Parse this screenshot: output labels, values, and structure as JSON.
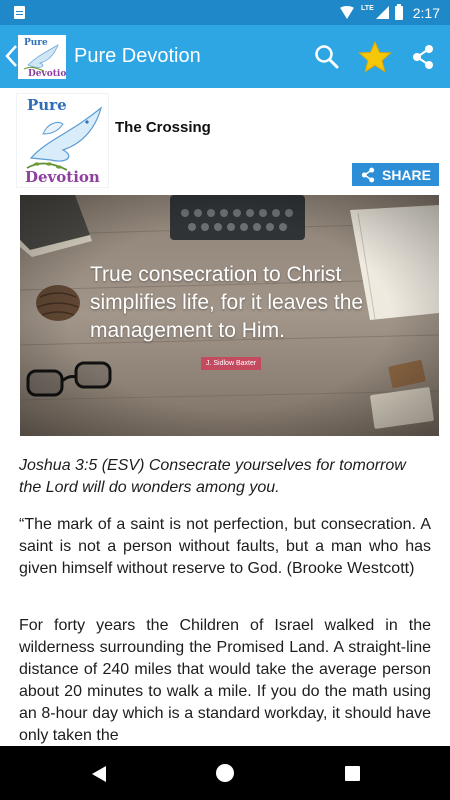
{
  "status_bar": {
    "network": "LTE",
    "battery_level": "2",
    "time": "2:17"
  },
  "app_bar": {
    "title": "Pure Devotion",
    "logo_text": [
      "Pure",
      "Devotion"
    ],
    "actions": [
      "search-icon",
      "star-icon",
      "share-icon"
    ],
    "star_color": "#f6c609"
  },
  "post": {
    "title": "The Crossing",
    "logo_text": [
      "Pure",
      "Devotion"
    ],
    "share_label": "SHARE",
    "image": {
      "quote": "True consecration to Christ simplifies life, for it leaves the management to Him.",
      "author": "J. Sidlow Baxter"
    },
    "verse": "Joshua 3:5 (ESV) Consecrate yourselves for tomorrow the Lord will do wonders among you.",
    "paragraphs": [
      "“The mark of a saint is not perfection, but consecration. A saint is not a person without faults, but a man who has given himself without reserve to God. (Brooke Westcott)",
      "For forty years the Children of Israel walked in the wilderness surrounding the Promised Land. A straight-line distance of 240 miles that would take the average person about 20 minutes to walk a mile. If you do the math using an 8-hour day which is a standard workday, it should have only taken the"
    ]
  },
  "colors": {
    "status_bar": "#1e88c9",
    "app_bar": "#2ea6e4",
    "share_button": "#2d8ed8",
    "logo_purple": "#8e3fa0",
    "logo_blue": "#2f6fb7"
  },
  "nav_bar": [
    "back-icon",
    "home-icon",
    "recent-apps-icon"
  ]
}
